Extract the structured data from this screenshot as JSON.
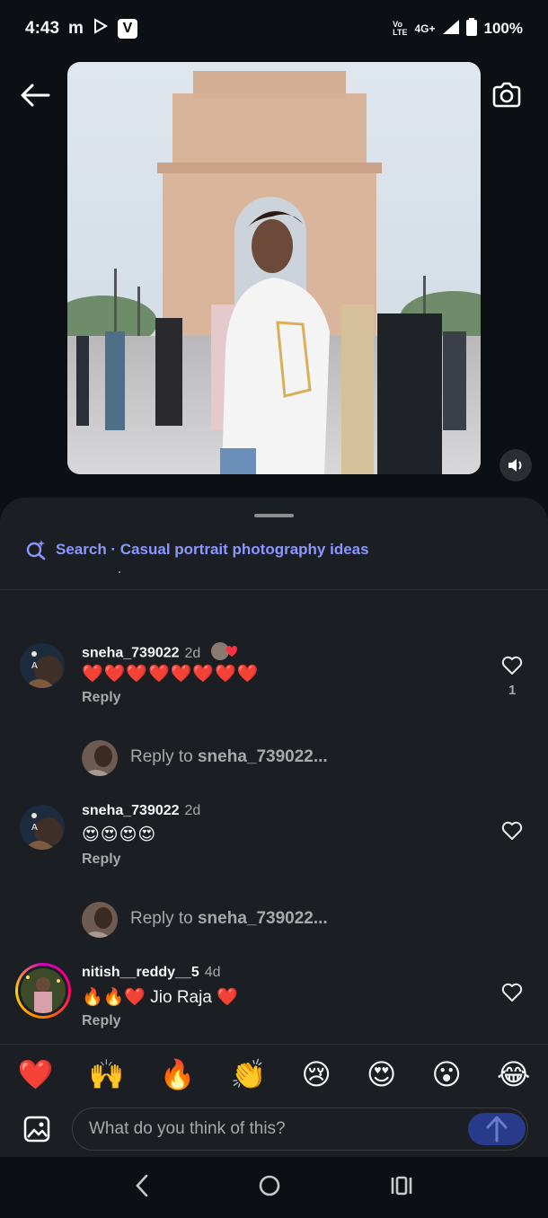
{
  "status_bar": {
    "time": "4:43",
    "carrier_mark": "m",
    "network_top": "Vo",
    "network_bottom": "LTE",
    "network_type": "4G+",
    "battery": "100%"
  },
  "search": {
    "label": "Search · Casual portrait photography ideas"
  },
  "comments": [
    {
      "username": "sneha_739022",
      "time": "2d",
      "text": "❤️❤️❤️❤️❤️❤️❤️❤️",
      "reply_label": "Reply",
      "likes": "1"
    },
    {
      "username": "sneha_739022",
      "time": "2d",
      "text": "😍😍😍😍",
      "reply_label": "Reply",
      "likes": ""
    },
    {
      "username": "nitish__reddy__5",
      "time": "4d",
      "text": "🔥🔥❤️ Jio Raja ❤️",
      "reply_label": "Reply",
      "likes": ""
    }
  ],
  "reply_prompts": [
    {
      "prefix": "Reply to",
      "target": "sneha_739022..."
    },
    {
      "prefix": "Reply to",
      "target": "sneha_739022..."
    }
  ],
  "quick_reactions": [
    "❤️",
    "🙌",
    "🔥",
    "👏",
    "😢",
    "😍",
    "😮",
    "😂"
  ],
  "composer": {
    "placeholder": "What do you think of this?"
  },
  "colors": {
    "accent": "#8b96ff",
    "send": "#283a8a",
    "sheet": "#1b1f23",
    "background": "#0c1014"
  }
}
